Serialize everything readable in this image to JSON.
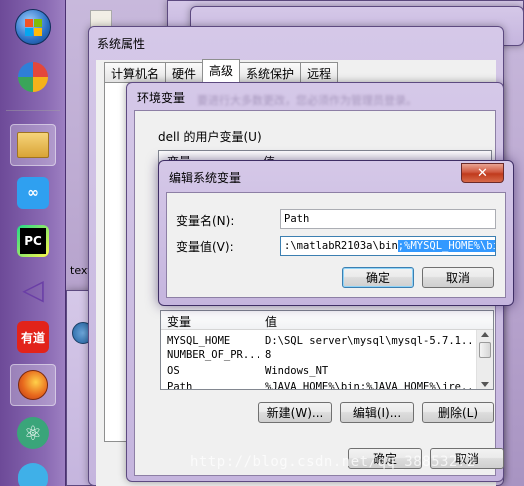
{
  "system_properties": {
    "title": "系统属性",
    "tabs": [
      "计算机名",
      "硬件",
      "高级",
      "系统保护",
      "远程"
    ],
    "selected_tab": "高级",
    "ok_label": "确定",
    "cancel_label": "取消"
  },
  "env_vars": {
    "title": "环境变量",
    "blurred_title_hint": "要进行大多数更改，您必须作为管理员登录。",
    "user_vars_label": "dell 的用户变量(U)",
    "user_header_var": "变量",
    "user_header_val": "值",
    "system_header_var": "变量",
    "system_header_val": "值",
    "system_rows": [
      {
        "name": "MYSQL_HOME",
        "value": "D:\\SQL server\\mysql\\mysql-5.7.1..."
      },
      {
        "name": "NUMBER_OF_PR...",
        "value": "8"
      },
      {
        "name": "OS",
        "value": "Windows_NT"
      },
      {
        "name": "Path",
        "value": "%JAVA_HOME%\\bin;%JAVA_HOME%\\jre..."
      }
    ],
    "new_label": "新建(W)...",
    "edit_label": "编辑(I)...",
    "delete_label": "删除(L)",
    "ok_label": "确定",
    "cancel_label": "取消"
  },
  "edit_dialog": {
    "title": "编辑系统变量",
    "close_label": "✕",
    "var_name_label": "变量名(N):",
    "var_value_label": "变量值(V):",
    "var_name_value": "Path",
    "var_value_plain": ":\\matlabR2103a\\bin",
    "var_value_selected": ";%MYSQL_HOME%\\bin",
    "ok_label": "确定",
    "cancel_label": "取消"
  },
  "desktop": {
    "file_label": "text"
  },
  "taskbar": {
    "items": [
      {
        "icon": "windows-start-icon",
        "color": "#2a7fd4"
      },
      {
        "icon": "pinwheel-app-icon",
        "color": "#e4473b"
      },
      {
        "icon": "file-explorer-icon",
        "color": "#e8b94a"
      },
      {
        "icon": "baidu-netdisk-icon",
        "color": "#2fa0f0"
      },
      {
        "icon": "pycharm-icon",
        "color": "#1d1d1d"
      },
      {
        "icon": "visual-studio-icon",
        "color": "#6a3ea6"
      },
      {
        "icon": "youdao-dict-icon",
        "color": "#e2231a"
      },
      {
        "icon": "firefox-icon",
        "color": "#e86a1d"
      },
      {
        "icon": "atom-icon",
        "color": "#3aa57a"
      },
      {
        "icon": "bird-app-icon",
        "color": "#3fb0e8"
      }
    ],
    "pc_label": "PC",
    "youdao_label": "有道"
  },
  "watermark": "http://blog.csdn.net/qq_38853272"
}
